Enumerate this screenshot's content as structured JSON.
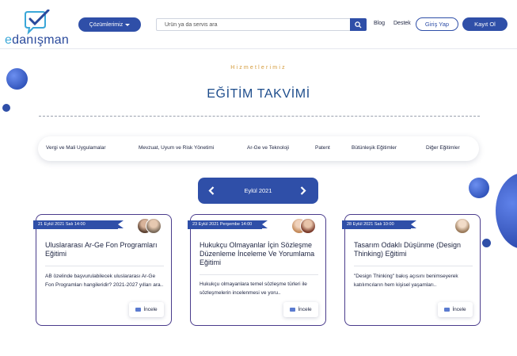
{
  "header": {
    "logo_text_prefix": "e",
    "logo_text_rest": "danışman",
    "solutions_label": "Çözümlerimiz",
    "search_placeholder": "Ürün ya da servis ara",
    "blog_label": "Blog",
    "support_label": "Destek",
    "login_label": "Giriş Yap",
    "signup_label": "Kayıt Ol"
  },
  "hero": {
    "eyebrow": "Hizmetlerimiz",
    "title": "EĞİTİM TAKVİMİ"
  },
  "categories": [
    "Vergi ve Mali Uygulamalar",
    "Mevzuat, Uyum ve Risk Yönetimi",
    "Ar-Ge ve Teknoloji",
    "Patent",
    "Bütünleşik Eğitimler",
    "Diğer Eğitimler"
  ],
  "month": {
    "label": "Eylül 2021"
  },
  "cards": [
    {
      "ribbon": "21 Eylül 2021 Salı 14:00",
      "title": "Uluslararası Ar-Ge Fon Programları Eğitimi",
      "desc": "AB özelinde başvurulabilecek uluslararası Ar-Ge Fon Programları hangileridir? 2021-2027 yılları ara..",
      "button": "İncele"
    },
    {
      "ribbon": "23 Eylül 2021 Perşembe 14:00",
      "title": "Hukukçu Olmayanlar İçin Sözleşme Düzenleme İnceleme Ve Yorumlama Eğitimi",
      "desc": "Hukukçu olmayanlara temel sözleşme türleri ile sözleşmelerin incelenmesi ve yoru..",
      "button": "İncele"
    },
    {
      "ribbon": "28 Eylül 2021 Salı 10:00",
      "title": "Tasarım Odaklı Düşünme (Design Thinking) Eğitimi",
      "desc": "\"Design Thinking\" bakış açısını benimseyerek katılımcıların hem kişisel yaşamları..",
      "button": "İncele"
    }
  ],
  "colors": {
    "primary": "#2f4fa8",
    "title": "#1e4d8c",
    "eyebrow": "#d49a3a",
    "card_border": "#4a3c8c"
  }
}
